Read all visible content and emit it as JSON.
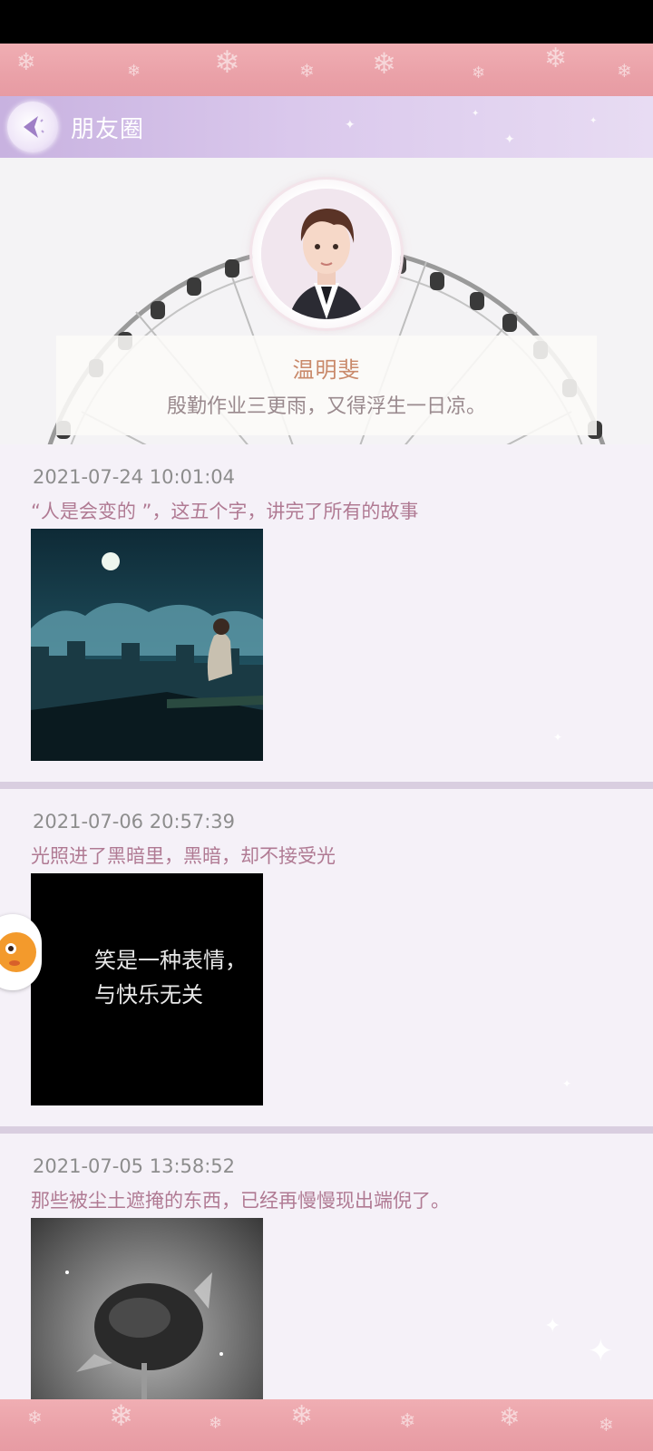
{
  "header": {
    "title": "朋友圈"
  },
  "profile": {
    "name": "温明斐",
    "signature": "殷勤作业三更雨，又得浮生一日凉。"
  },
  "posts": [
    {
      "time": "2021-07-24 10:01:04",
      "text": "“人是会变的 ”，这五个字，讲完了所有的故事"
    },
    {
      "time": "2021-07-06 20:57:39",
      "text": "光照进了黑暗里，黑暗，却不接受光",
      "image_text": [
        "笑是一种表情，",
        "与快乐无关"
      ]
    },
    {
      "time": "2021-07-05 13:58:52",
      "text": "那些被尘土遮掩的东西，已经再慢慢现出端倪了。"
    }
  ],
  "icons": {
    "back": "back-arrow-icon",
    "float": "pet-shortcut-icon"
  },
  "colors": {
    "header_start": "#c8b2e0",
    "snow_band": "#eaa1a8",
    "name": "#c9896a",
    "post_text": "#b07a93",
    "time_text": "#8d8d8d"
  }
}
